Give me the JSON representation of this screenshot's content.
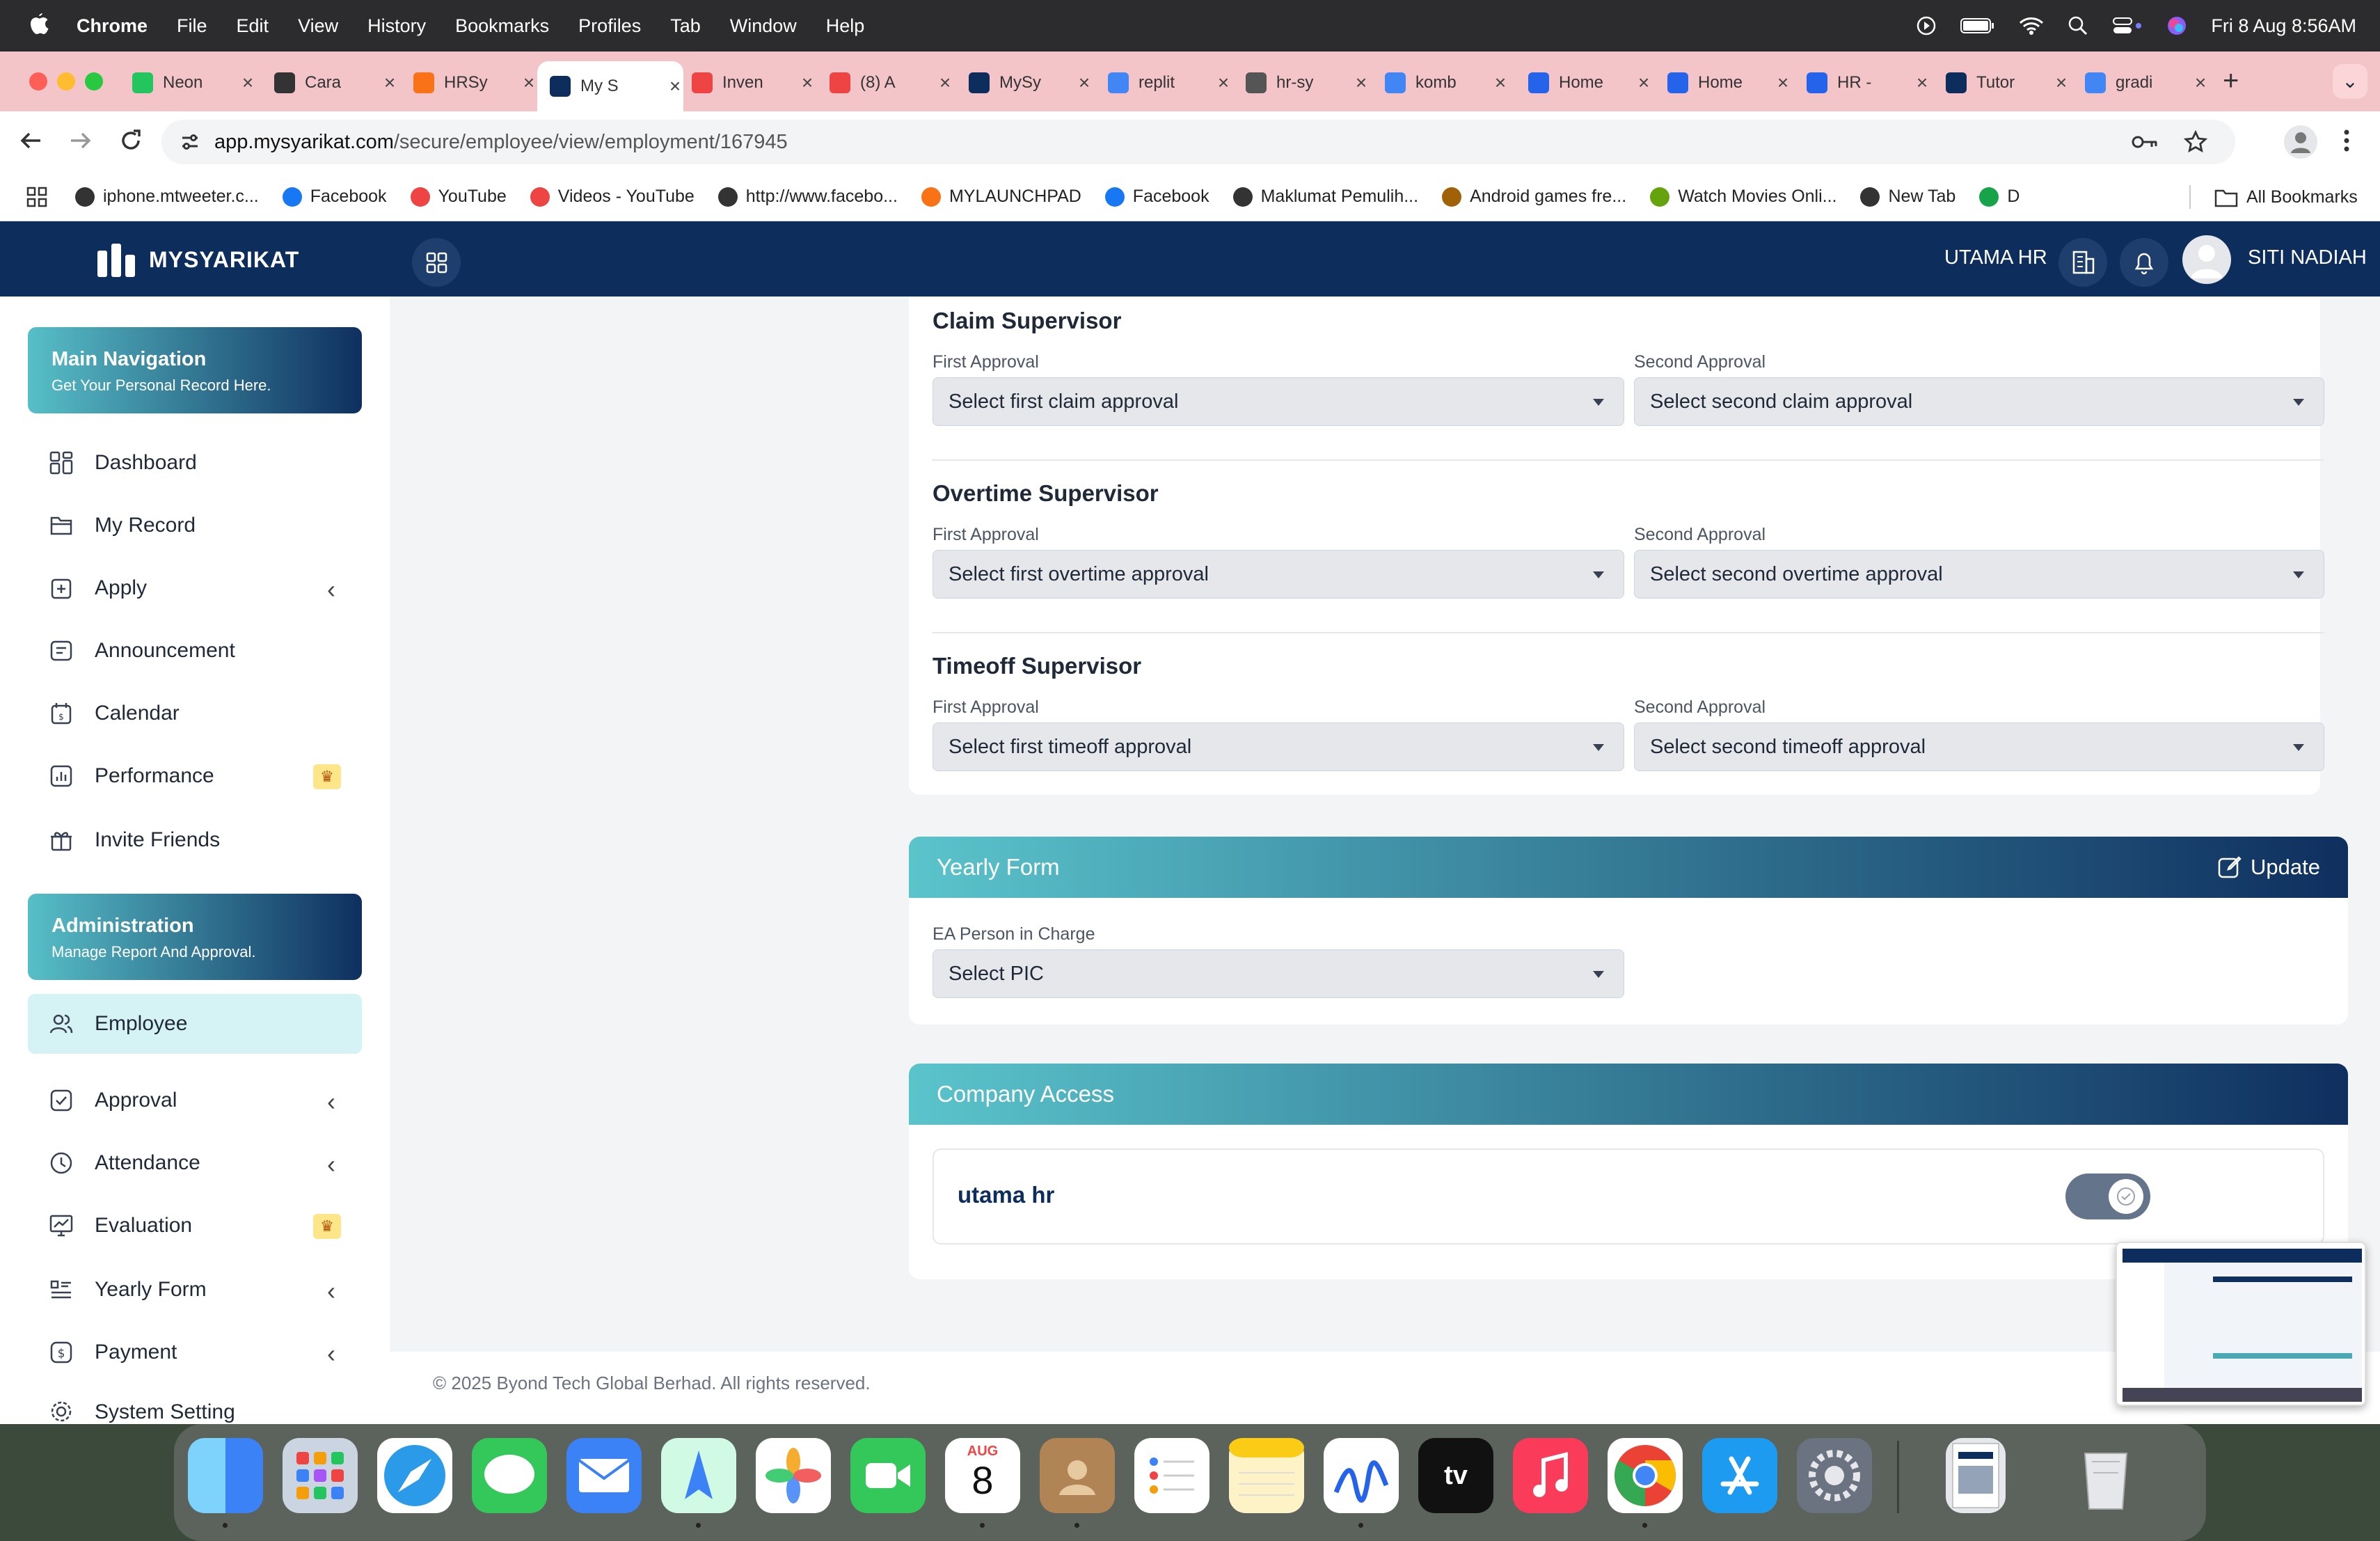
{
  "menubar": {
    "app": "Chrome",
    "items": [
      "File",
      "Edit",
      "View",
      "History",
      "Bookmarks",
      "Profiles",
      "Tab",
      "Window",
      "Help"
    ],
    "clock": "Fri 8 Aug  8:56AM"
  },
  "tabs": [
    {
      "label": "Neon",
      "color": "#22c55e"
    },
    {
      "label": "Cara",
      "color": "#333333"
    },
    {
      "label": "HRSy",
      "color": "#f97316"
    },
    {
      "label": "My S",
      "color": "#0d2d5c"
    },
    {
      "label": "Inven",
      "color": "#ef4444"
    },
    {
      "label": "(8) A",
      "color": "#ef4444"
    },
    {
      "label": "MySy",
      "color": "#0d2d5c"
    },
    {
      "label": "replit",
      "color": "#4285f4"
    },
    {
      "label": "hr-sy",
      "color": "#555555"
    },
    {
      "label": "komb",
      "color": "#4285f4"
    },
    {
      "label": "Home",
      "color": "#2563eb"
    },
    {
      "label": "Home",
      "color": "#2563eb"
    },
    {
      "label": "HR -",
      "color": "#2563eb"
    },
    {
      "label": "Tutor",
      "color": "#0d2d5c"
    },
    {
      "label": "gradi",
      "color": "#4285f4"
    }
  ],
  "address": {
    "host": "app.mysyarikat.com",
    "path": "/secure/employee/view/employment/167945"
  },
  "bookmarks": [
    {
      "label": "iphone.mtweeter.c...",
      "color": "#333333"
    },
    {
      "label": "Facebook",
      "color": "#1877f2"
    },
    {
      "label": "YouTube",
      "color": "#ef4444"
    },
    {
      "label": "Videos - YouTube",
      "color": "#ef4444"
    },
    {
      "label": "http://www.facebo...",
      "color": "#333333"
    },
    {
      "label": "MYLAUNCHPAD",
      "color": "#f97316"
    },
    {
      "label": "Facebook",
      "color": "#1877f2"
    },
    {
      "label": "Maklumat Pemulih...",
      "color": "#333333"
    },
    {
      "label": "Android games fre...",
      "color": "#a16207"
    },
    {
      "label": "Watch Movies Onli...",
      "color": "#65a30d"
    },
    {
      "label": "New Tab",
      "color": "#333333"
    },
    {
      "label": "D",
      "color": "#16a34a"
    }
  ],
  "all_bookmarks": "All Bookmarks",
  "app": {
    "brand": "MYSYARIKAT",
    "company": "UTAMA HR",
    "user": "SITI NADIAH"
  },
  "sidebar": {
    "main_title": "Main Navigation",
    "main_sub": "Get Your Personal Record Here.",
    "items": [
      {
        "label": "Dashboard",
        "icon": "grid-icon"
      },
      {
        "label": "My Record",
        "icon": "folder-icon"
      },
      {
        "label": "Apply",
        "icon": "apply-icon"
      },
      {
        "label": "Announcement",
        "icon": "announcement-icon"
      },
      {
        "label": "Calendar",
        "icon": "calendar-icon"
      },
      {
        "label": "Performance",
        "icon": "chart-icon"
      },
      {
        "label": "Invite Friends",
        "icon": "gift-icon"
      }
    ],
    "admin_title": "Administration",
    "admin_sub": "Manage Report And Approval.",
    "admin_items": [
      {
        "label": "Employee",
        "icon": "users-icon"
      },
      {
        "label": "Approval",
        "icon": "check-icon"
      },
      {
        "label": "Attendance",
        "icon": "clock-icon"
      },
      {
        "label": "Evaluation",
        "icon": "evaluation-icon"
      },
      {
        "label": "Yearly Form",
        "icon": "list-icon"
      },
      {
        "label": "Payment",
        "icon": "dollar-icon"
      },
      {
        "label": "System Setting",
        "icon": "gear-icon"
      }
    ]
  },
  "supervisors": [
    {
      "title": "Claim Supervisor",
      "first_label": "First Approval",
      "first": "Select first claim approval",
      "second_label": "Second Approval",
      "second": "Select second claim approval"
    },
    {
      "title": "Overtime Supervisor",
      "first_label": "First Approval",
      "first": "Select first overtime approval",
      "second_label": "Second Approval",
      "second": "Select second overtime approval"
    },
    {
      "title": "Timeoff Supervisor",
      "first_label": "First Approval",
      "first": "Select first timeoff approval",
      "second_label": "Second Approval",
      "second": "Select second timeoff approval"
    }
  ],
  "yearly": {
    "title": "Yearly Form",
    "update": "Update",
    "field_label": "EA Person in Charge",
    "field_value": "Select PIC"
  },
  "access": {
    "title": "Company Access",
    "company": "utama hr",
    "enabled": true
  },
  "footer": "© 2025 Byond Tech Global Berhad. All rights reserved.",
  "dock": {
    "calendar_month": "AUG",
    "calendar_day": "8"
  }
}
